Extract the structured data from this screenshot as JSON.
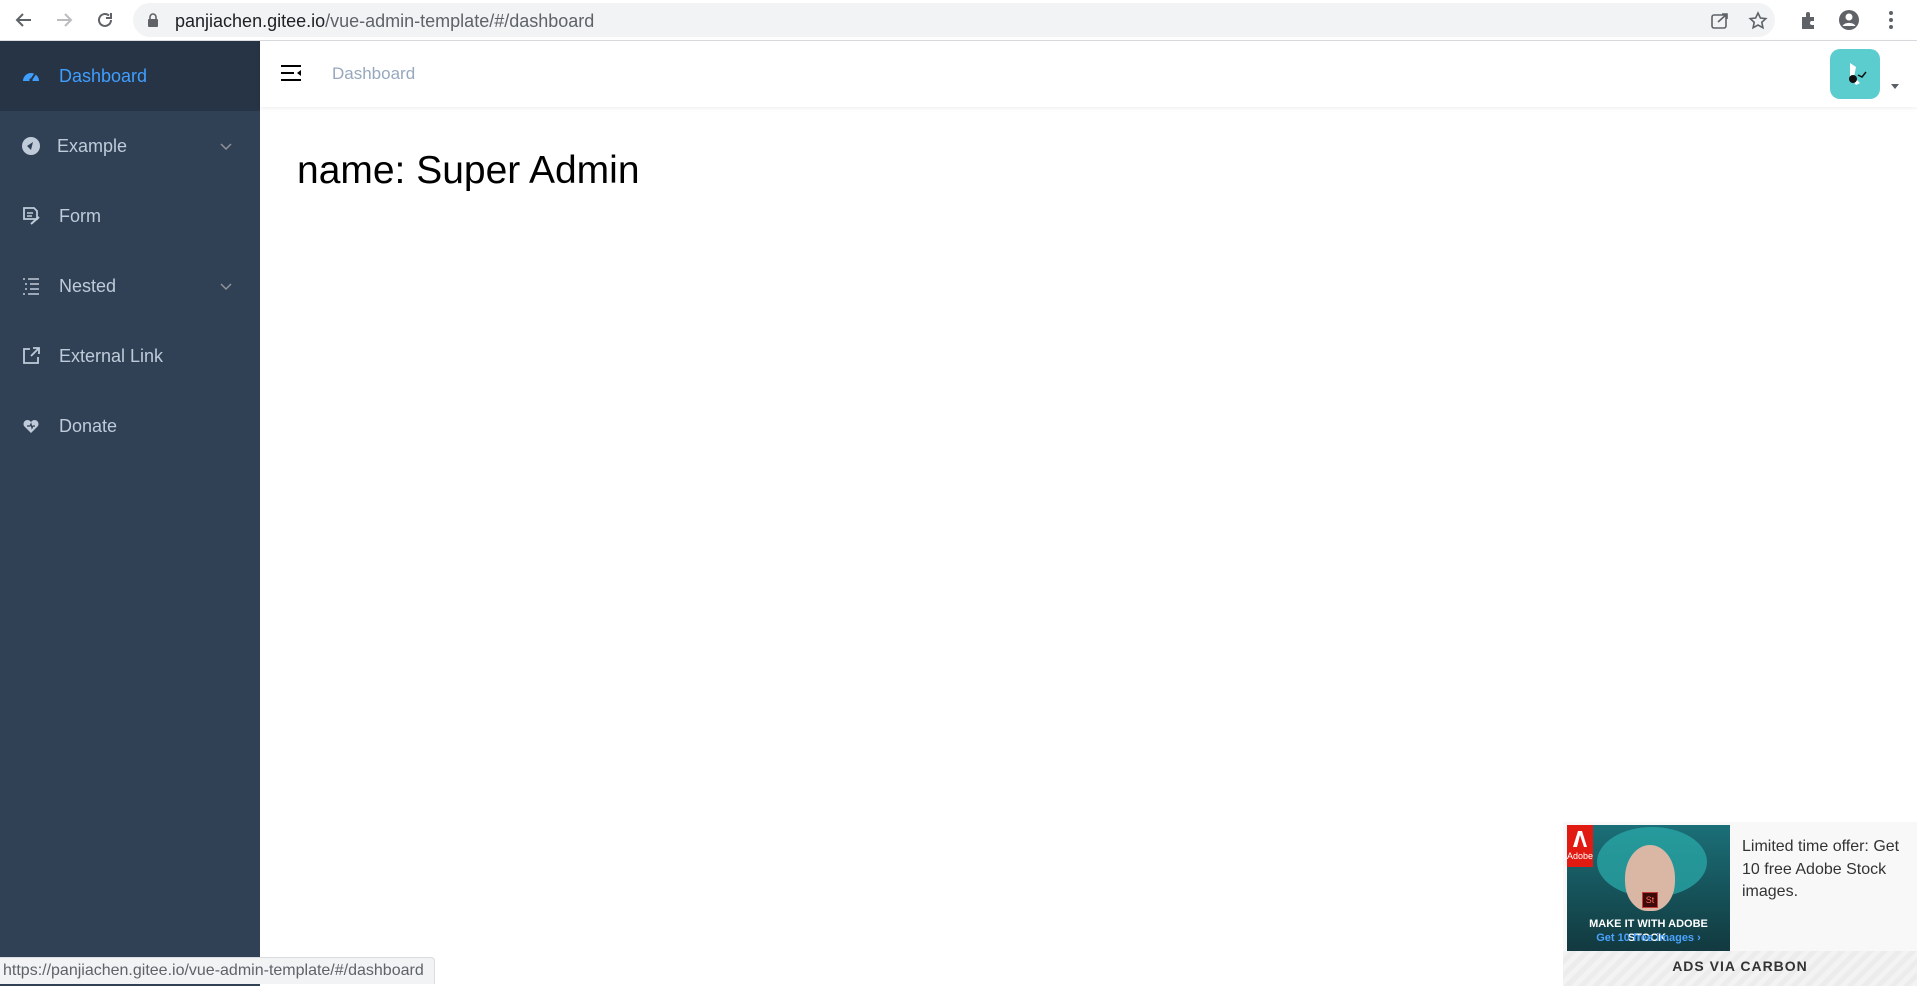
{
  "browser": {
    "url_host": "panjiachen.gitee.io",
    "url_path": "/vue-admin-template/#/dashboard"
  },
  "sidebar": {
    "items": [
      {
        "label": "Dashboard",
        "icon": "dashboard-icon",
        "active": true
      },
      {
        "label": "Example",
        "icon": "example-icon",
        "has_children": true
      },
      {
        "label": "Form",
        "icon": "form-icon"
      },
      {
        "label": "Nested",
        "icon": "nested-icon",
        "has_children": true
      },
      {
        "label": "External Link",
        "icon": "external-link-icon"
      },
      {
        "label": "Donate",
        "icon": "donate-icon"
      }
    ]
  },
  "navbar": {
    "breadcrumb": "Dashboard"
  },
  "main": {
    "dashboard_text": "name: Super Admin"
  },
  "ad": {
    "image_tagline": "MAKE IT WITH ADOBE STOCK.",
    "image_cta": "Get 10 free images ›",
    "badge": "St",
    "logo_text": "Adobe",
    "text": "Limited time offer: Get 10 free Adobe Stock images.",
    "powered_by": "ADS VIA CARBON"
  },
  "status_bar": {
    "url": "https://panjiachen.gitee.io/vue-admin-template/#/dashboard"
  },
  "colors": {
    "sidebar_bg": "#304156",
    "sidebar_active_bg": "#263445",
    "sidebar_text": "#bfcbd9",
    "active_text": "#409eff",
    "breadcrumb_text": "#97a8be",
    "avatar_bg": "#5ccdcf"
  }
}
